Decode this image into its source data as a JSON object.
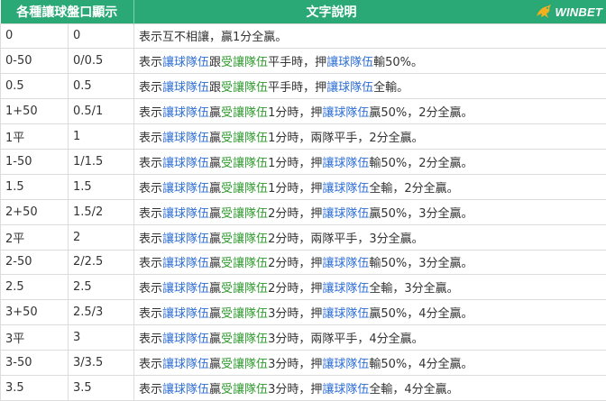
{
  "brand": {
    "logo_text": "WINBET"
  },
  "header": {
    "col_handicap": "各種讓球盤口顯示",
    "col_desc": "文字說明"
  },
  "rows": [
    {
      "label": "0",
      "value": "0",
      "desc": "表示互不相讓，贏1分全贏。"
    },
    {
      "label": "0-50",
      "value": "0/0.5",
      "desc": "表示讓球隊伍跟受讓隊伍平手時，押讓球隊伍輸50%。"
    },
    {
      "label": "0.5",
      "value": "0.5",
      "desc": "表示讓球隊伍跟受讓隊伍平手時，押讓球隊伍全輸。"
    },
    {
      "label": "1+50",
      "value": "0.5/1",
      "desc": "表示讓球隊伍贏受讓隊伍1分時，押讓球隊伍贏50%，2分全贏。"
    },
    {
      "label": "1平",
      "value": "1",
      "desc": "表示讓球隊伍贏受讓隊伍1分時，兩隊平手，2分全贏。"
    },
    {
      "label": "1-50",
      "value": "1/1.5",
      "desc": "表示讓球隊伍贏受讓隊伍1分時，押讓球隊伍輸50%，2分全贏。"
    },
    {
      "label": "1.5",
      "value": "1.5",
      "desc": "表示讓球隊伍贏受讓隊伍1分時，押讓球隊伍全輸，2分全贏。"
    },
    {
      "label": "2+50",
      "value": "1.5/2",
      "desc": "表示讓球隊伍贏受讓隊伍2分時，押讓球隊伍贏50%，3分全贏。"
    },
    {
      "label": "2平",
      "value": "2",
      "desc": "表示讓球隊伍贏受讓隊伍2分時，兩隊平手，3分全贏。"
    },
    {
      "label": "2-50",
      "value": "2/2.5",
      "desc": "表示讓球隊伍贏受讓隊伍2分時，押讓球隊伍輸50%，3分全贏。"
    },
    {
      "label": "2.5",
      "value": "2.5",
      "desc": "表示讓球隊伍贏受讓隊伍2分時，押讓球隊伍全輸，3分全贏。"
    },
    {
      "label": "3+50",
      "value": "2.5/3",
      "desc": "表示讓球隊伍贏受讓隊伍3分時，押讓球隊伍贏50%，4分全贏。"
    },
    {
      "label": "3平",
      "value": "3",
      "desc": "表示讓球隊伍贏受讓隊伍3分時，兩隊平手，4分全贏。"
    },
    {
      "label": "3-50",
      "value": "3/3.5",
      "desc": "表示讓球隊伍贏受讓隊伍3分時，押讓球隊伍輸50%，4分全贏。"
    },
    {
      "label": "3.5",
      "value": "3.5",
      "desc": "表示讓球隊伍贏受讓隊伍3分時，押讓球隊伍全輸，4分全贏。"
    }
  ],
  "highlight_terms": [
    {
      "text": "讓球隊伍",
      "color": "#2f6fd6"
    },
    {
      "text": "受讓隊伍",
      "color": "#2e9a2e"
    }
  ],
  "colors": {
    "header_bg": "#2aa876",
    "header_text": "#ffffff",
    "border": "#dcdcdc"
  }
}
